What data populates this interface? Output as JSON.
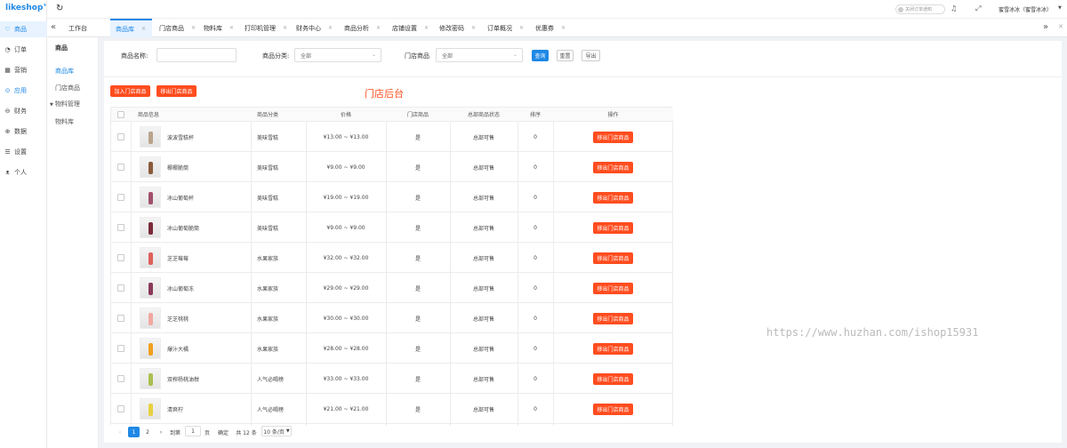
{
  "app": {
    "logo": "likeshop",
    "user": "蜜雪冰冰（蜜雪冰冰）",
    "notify_toggle": "关闭订单通知"
  },
  "nav": [
    {
      "label": "商品",
      "icon": "heart-icon",
      "active": true
    },
    {
      "label": "订单",
      "icon": "bell-icon"
    },
    {
      "label": "营销",
      "icon": "chart-icon"
    },
    {
      "label": "应用",
      "icon": "apps-icon",
      "highlight": true
    },
    {
      "label": "财务",
      "icon": "money-icon"
    },
    {
      "label": "数据",
      "icon": "data-icon"
    },
    {
      "label": "设置",
      "icon": "settings-icon"
    },
    {
      "label": "个人",
      "icon": "user-icon"
    }
  ],
  "tabs": [
    "工作台",
    "商品库",
    "门店商品",
    "物料库",
    "打印机管理",
    "财务中心",
    "商品分析",
    "店铺设置",
    "修改密码",
    "订单概况",
    "优惠券"
  ],
  "subnav": {
    "title": "商品",
    "items": [
      "商品库",
      "门店商品",
      "物料管理",
      "物料库"
    ]
  },
  "filters": {
    "name_label": "商品名称:",
    "category_label": "商品分类:",
    "category_value": "全部",
    "store_label": "门店商品",
    "store_value": "全部",
    "query": "查询",
    "reset": "重置",
    "export": "导出"
  },
  "actions": {
    "add": "加入门店商品",
    "remove": "移出门店商品"
  },
  "overlay_label": "门店后台",
  "table": {
    "headers": [
      "商品信息",
      "商品分类",
      "价格",
      "门店商品",
      "总部商品状态",
      "排序",
      "操作"
    ],
    "row_action": "移出门店商品",
    "rows": [
      {
        "name": "波波雪糕杯",
        "category": "美味雪糕",
        "price": "¥13.00 ~ ¥13.00",
        "store": "是",
        "status": "总部可售",
        "sort": "0",
        "color": "#b9a38b"
      },
      {
        "name": "椰椰脆筒",
        "category": "美味雪糕",
        "price": "¥9.00 ~ ¥9.00",
        "store": "是",
        "status": "总部可售",
        "sort": "0",
        "color": "#8a5a3c"
      },
      {
        "name": "冰山葡萄杯",
        "category": "美味雪糕",
        "price": "¥19.00 ~ ¥19.00",
        "store": "是",
        "status": "总部可售",
        "sort": "0",
        "color": "#a0506a"
      },
      {
        "name": "冰山葡萄脆筒",
        "category": "美味雪糕",
        "price": "¥9.00 ~ ¥9.00",
        "store": "是",
        "status": "总部可售",
        "sort": "0",
        "color": "#7a2a3a"
      },
      {
        "name": "芝芝莓莓",
        "category": "水果家族",
        "price": "¥32.00 ~ ¥32.00",
        "store": "是",
        "status": "总部可售",
        "sort": "0",
        "color": "#e0605a"
      },
      {
        "name": "冰山葡萄冻",
        "category": "水果家族",
        "price": "¥29.00 ~ ¥29.00",
        "store": "是",
        "status": "总部可售",
        "sort": "0",
        "color": "#8a3a5a"
      },
      {
        "name": "芝芝桃桃",
        "category": "水果家族",
        "price": "¥30.00 ~ ¥30.00",
        "store": "是",
        "status": "总部可售",
        "sort": "0",
        "color": "#f0a8a0"
      },
      {
        "name": "爆汁大橘",
        "category": "水果家族",
        "price": "¥28.00 ~ ¥28.00",
        "store": "是",
        "status": "总部可售",
        "sort": "0",
        "color": "#f0a020"
      },
      {
        "name": "双榨杨桃油柑",
        "category": "人气必喝榜",
        "price": "¥33.00 ~ ¥33.00",
        "store": "是",
        "status": "总部可售",
        "sort": "0",
        "color": "#a8c050"
      },
      {
        "name": "清爽柠",
        "category": "人气必喝榜",
        "price": "¥21.00 ~ ¥21.00",
        "store": "是",
        "status": "总部可售",
        "sort": "0",
        "color": "#e8d040"
      }
    ]
  },
  "pager": {
    "current": "1",
    "next": "2",
    "goto_label": "到第",
    "goto_value": "1",
    "page_unit": "页",
    "confirm": "确定",
    "total": "共 12 条",
    "page_size": "10 条/页"
  },
  "watermark": "https://www.huzhan.com/ishop15931"
}
